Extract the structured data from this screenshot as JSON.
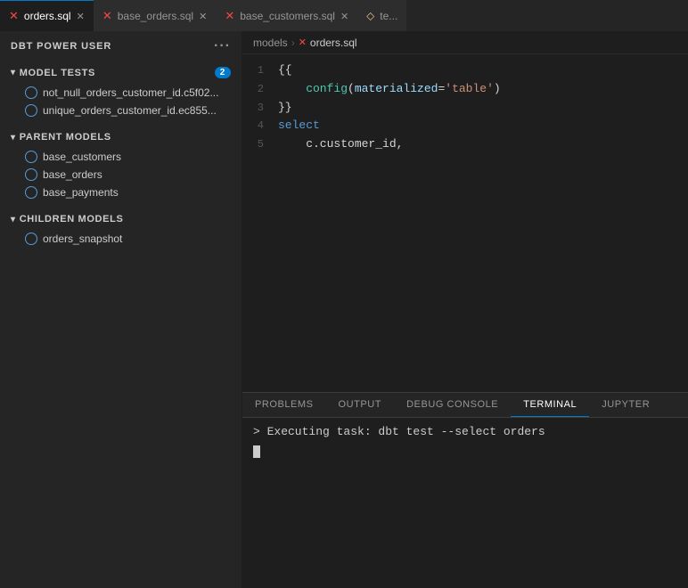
{
  "tabs": [
    {
      "label": "orders.sql",
      "icon": "✕",
      "iconColor": "red",
      "active": true
    },
    {
      "label": "base_orders.sql",
      "icon": "✕",
      "iconColor": "red",
      "active": false
    },
    {
      "label": "base_customers.sql",
      "icon": "✕",
      "iconColor": "red",
      "active": false
    },
    {
      "label": "te...",
      "icon": "",
      "iconColor": "yellow",
      "active": false
    }
  ],
  "sidebar": {
    "app_title": "DBT POWER USER",
    "dots_label": "···",
    "sections": [
      {
        "id": "model-tests",
        "label": "MODEL TESTS",
        "badge": "2",
        "items": [
          {
            "label": "not_null_orders_customer_id.c5f02...",
            "id": "test-1"
          },
          {
            "label": "unique_orders_customer_id.ec855...",
            "id": "test-2"
          }
        ]
      },
      {
        "id": "parent-models",
        "label": "PARENT MODELS",
        "badge": null,
        "items": [
          {
            "label": "base_customers",
            "id": "parent-1"
          },
          {
            "label": "base_orders",
            "id": "parent-2"
          },
          {
            "label": "base_payments",
            "id": "parent-3"
          }
        ]
      },
      {
        "id": "children-models",
        "label": "CHILDREN MODELS",
        "badge": null,
        "items": [
          {
            "label": "orders_snapshot",
            "id": "child-1"
          }
        ]
      }
    ]
  },
  "breadcrumb": {
    "folder": "models",
    "separator": "›",
    "file": "orders.sql"
  },
  "code": {
    "lines": [
      {
        "num": 1,
        "content": "{{"
      },
      {
        "num": 2,
        "content": "    config(materialized='table')"
      },
      {
        "num": 3,
        "content": "}}"
      },
      {
        "num": 4,
        "content": "select"
      },
      {
        "num": 5,
        "content": "    c.customer_id,"
      }
    ]
  },
  "terminal": {
    "tabs": [
      {
        "label": "PROBLEMS",
        "active": false
      },
      {
        "label": "OUTPUT",
        "active": false
      },
      {
        "label": "DEBUG CONSOLE",
        "active": false
      },
      {
        "label": "TERMINAL",
        "active": true
      },
      {
        "label": "JUPYTER",
        "active": false
      }
    ],
    "command": "> Executing task: dbt test --select orders"
  }
}
